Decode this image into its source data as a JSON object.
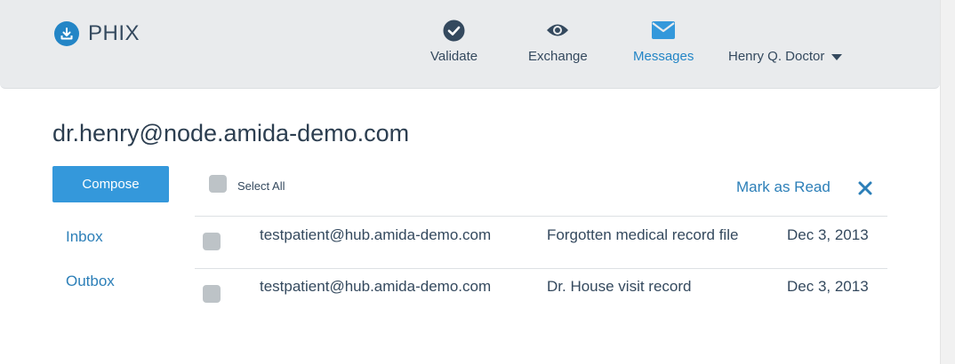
{
  "brand": {
    "name": "PHIX"
  },
  "nav": {
    "items": [
      {
        "label": "Validate",
        "icon": "check-circle-icon"
      },
      {
        "label": "Exchange",
        "icon": "eye-icon"
      },
      {
        "label": "Messages",
        "icon": "envelope-icon",
        "active": true
      }
    ],
    "user": "Henry Q. Doctor"
  },
  "mailbox": {
    "address": "dr.henry@node.amida-demo.com"
  },
  "sidebar": {
    "compose_label": "Compose",
    "links": [
      "Inbox",
      "Outbox"
    ]
  },
  "toolbar": {
    "select_all_label": "Select All",
    "mark_read_label": "Mark as Read"
  },
  "messages": [
    {
      "from": "testpatient@hub.amida-demo.com",
      "subject": "Forgotten medical record file",
      "date": "Dec 3, 2013"
    },
    {
      "from": "testpatient@hub.amida-demo.com",
      "subject": "Dr. House visit record",
      "date": "Dec 3, 2013"
    }
  ],
  "colors": {
    "accent": "#3498db",
    "link": "#2c7fb8",
    "text": "#34495e",
    "navbar": "#e9ebed",
    "checkbox": "#bdc3c7"
  }
}
